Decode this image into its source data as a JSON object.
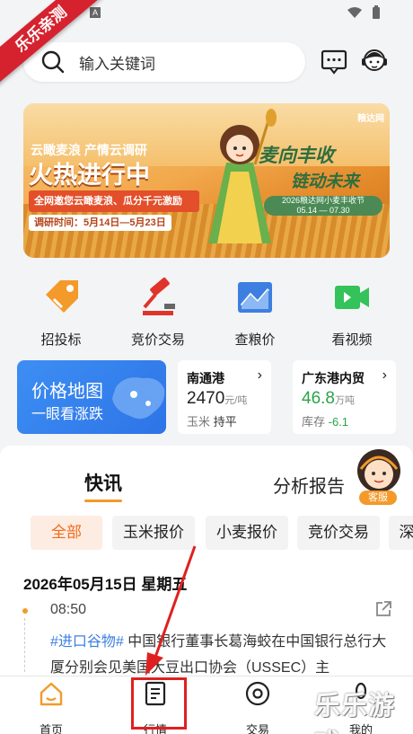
{
  "watermark": {
    "ribbon": "乐乐亲测",
    "bottom": "乐乐游戏"
  },
  "status_bar": {
    "time": "",
    "icons": [
      "a-icon",
      "wifi-icon",
      "battery-icon"
    ]
  },
  "search": {
    "placeholder": "输入关键词"
  },
  "banner": {
    "logo": "粮达网",
    "line1": "云瞰麦浪 产情云调研",
    "line2": "火热进行中",
    "pill": "全网邀您云瞰麦浪、瓜分千元激励",
    "dates": "调研时间：5月14日—5月23日",
    "right_title_1": "麦向丰收",
    "right_title_2": "链动未来",
    "right_sub_1": "2026粮达网小麦丰收节",
    "right_sub_2": "05.14 — 07.30"
  },
  "quick_actions": [
    {
      "label": "招投标",
      "icon": "tag-icon",
      "color": "#f39a2a"
    },
    {
      "label": "竞价交易",
      "icon": "gavel-icon",
      "color": "#e0342b"
    },
    {
      "label": "查粮价",
      "icon": "chart-icon",
      "color": "#3d7fe0"
    },
    {
      "label": "看视频",
      "icon": "video-icon",
      "color": "#34c35a"
    }
  ],
  "price_map": {
    "title": "价格地图",
    "subtitle": "一眼看涨跌"
  },
  "cards": [
    {
      "name": "南通港",
      "price": "2470",
      "unit": "元/吨",
      "sub_label": "玉米",
      "sub_value": "持平"
    },
    {
      "name": "广东港内贸",
      "price": "46.8",
      "unit": "万吨",
      "sub_label": "库存",
      "sub_value": "-6.1"
    }
  ],
  "tabs": {
    "primary": "快讯",
    "secondary": "分析报告",
    "kefu": "客服"
  },
  "chips": [
    "全部",
    "玉米报价",
    "小麦报价",
    "竞价交易",
    "深"
  ],
  "news": {
    "date": "2026年05月15日 星期五",
    "time": "08:50",
    "tag": "#进口谷物#",
    "text": " 中国银行董事长葛海蛟在中国银行总行大厦分别会见美国大豆出口协会（USSEC）主"
  },
  "bottom_nav": [
    {
      "label": "首页",
      "icon": "home-icon"
    },
    {
      "label": "行情",
      "icon": "market-icon"
    },
    {
      "label": "交易",
      "icon": "trade-icon"
    },
    {
      "label": "我的",
      "icon": "profile-icon"
    }
  ],
  "colors": {
    "accent": "#f39a2a",
    "blue": "#3d7fe0",
    "green": "#2ba447",
    "highlight": "#e02020"
  }
}
